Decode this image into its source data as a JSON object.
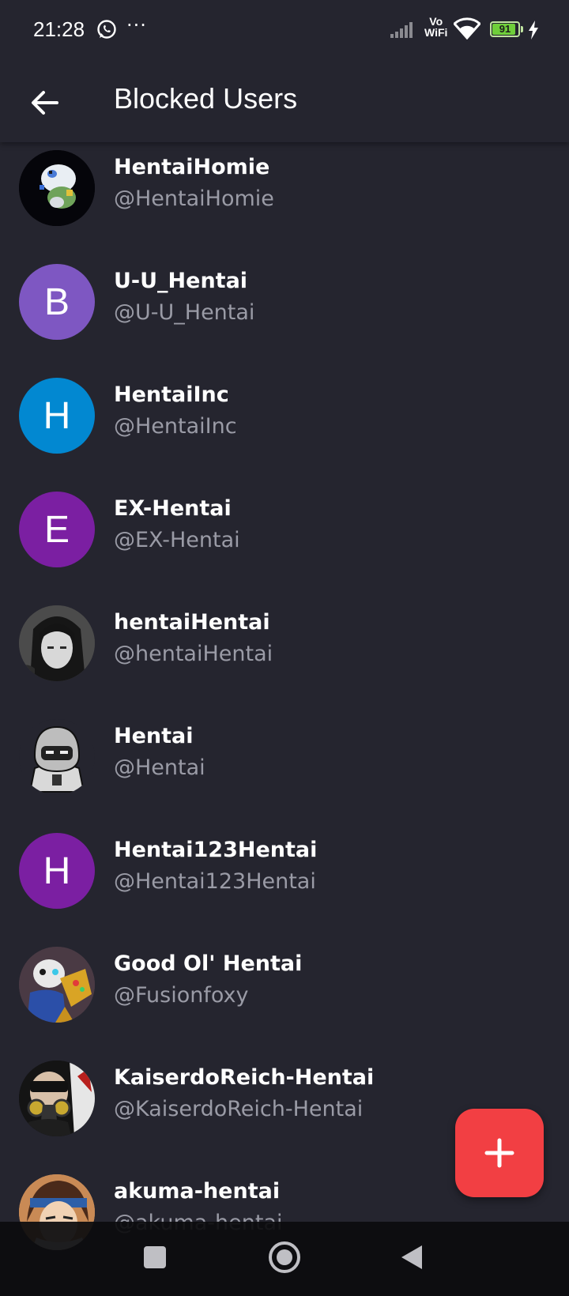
{
  "status_bar": {
    "time": "21:28",
    "more": "···",
    "vowifi_top": "Vo",
    "vowifi_bottom": "WiFi",
    "battery_level": "91",
    "battery_fraction": 0.91,
    "battery_color": "#6fcf3a"
  },
  "app_bar": {
    "title": "Blocked Users",
    "back_icon": "arrow-left-icon"
  },
  "users": [
    {
      "name": "HentaiHomie",
      "handle": "@HentaiHomie",
      "avatar_type": "image",
      "avatar_desc": "pixel-creature"
    },
    {
      "name": "U-U_Hentai",
      "handle": "@U-U_Hentai",
      "avatar_type": "letter",
      "letter": "B",
      "color": "#7e57c2"
    },
    {
      "name": "HentaiInc",
      "handle": "@HentaiInc",
      "avatar_type": "letter",
      "letter": "H",
      "color": "#0288d1"
    },
    {
      "name": "EX-Hentai",
      "handle": "@EX-Hentai",
      "avatar_type": "letter",
      "letter": "E",
      "color": "#7b1fa2"
    },
    {
      "name": "hentaiHentai",
      "handle": "@hentaiHentai",
      "avatar_type": "image",
      "avatar_desc": "manga-girl"
    },
    {
      "name": "Hentai",
      "handle": "@Hentai",
      "avatar_type": "image",
      "avatar_desc": "hooded-ninja"
    },
    {
      "name": "Hentai123Hentai",
      "handle": "@Hentai123Hentai",
      "avatar_type": "letter",
      "letter": "H",
      "color": "#7b1fa2"
    },
    {
      "name": "Good Ol' Hentai",
      "handle": "@Fusionfoxy",
      "avatar_type": "image",
      "avatar_desc": "skeleton-gauntlet"
    },
    {
      "name": "KaiserdoReich-Hentai",
      "handle": "@KaiserdoReich-Hentai",
      "avatar_type": "image",
      "avatar_desc": "gas-mask"
    },
    {
      "name": "akuma-hentai",
      "handle": "@akuma-hentai",
      "avatar_type": "image",
      "avatar_desc": "anime-headband"
    }
  ],
  "fab": {
    "icon": "plus-icon",
    "color": "#f23f43"
  },
  "nav_bar": {
    "recents_icon": "square-icon",
    "home_icon": "circle-icon",
    "back_icon": "triangle-back-icon"
  }
}
